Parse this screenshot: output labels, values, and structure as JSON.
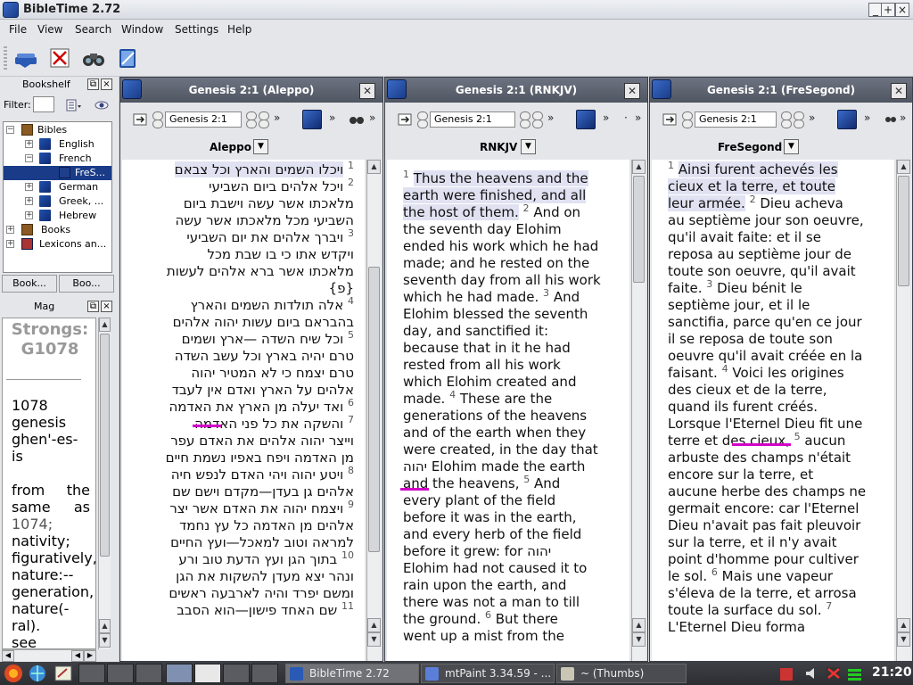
{
  "window": {
    "title": "BibleTime 2.72",
    "min": "_",
    "max": "+",
    "close": "×"
  },
  "menubar": [
    "File",
    "View",
    "Search",
    "Window",
    "Settings",
    "Help"
  ],
  "bookshelf": {
    "title": "Bookshelf",
    "filter_label": "Filter:",
    "tree": [
      {
        "label": "Bibles",
        "level": 0,
        "expanded": true
      },
      {
        "label": "English",
        "level": 1
      },
      {
        "label": "French",
        "level": 1,
        "expanded": true
      },
      {
        "label": "FreS...",
        "level": 2,
        "selected": true
      },
      {
        "label": "German",
        "level": 1
      },
      {
        "label": "Greek, ...",
        "level": 1
      },
      {
        "label": "Hebrew",
        "level": 1
      },
      {
        "label": "Books",
        "level": 0
      },
      {
        "label": "Lexicons an...",
        "level": 0
      }
    ],
    "tabs": [
      "Book...",
      "Boo..."
    ]
  },
  "mag": {
    "title": "Mag",
    "heading": "Strongs: G1078",
    "lines": [
      "1078",
      "genesis",
      "ghen'-es-",
      "is",
      "",
      "from the",
      "same as",
      "1074;",
      "nativity;",
      "figuratively,",
      "nature:--",
      "generation,",
      "nature(-",
      "ral).",
      "see"
    ]
  },
  "panes": [
    {
      "title": "Genesis 2:1 (Aleppo)",
      "key": "Genesis 2:1",
      "module": "Aleppo",
      "dir": "rtl",
      "lines": [
        "<span class='vn'>1</span> <span class='hl'>ויכלו השמים והארץ וכל צבאם</span>",
        "<span class='vn'>2</span> ויכל אלהים ביום השביעי",
        "מלאכתו אשר עשה וישבת ביום",
        "השביעי מכל מלאכתו אשר עשה",
        "<span class='vn'>3</span> ויברך אלהים את יום השביעי",
        "ויקדש אתו כי בו שבת מכל",
        "מלאכתו אשר ברא אלהים לעשות",
        "{פ}",
        "<span class='vn'>4</span> אלה תולדות השמים והארץ",
        "בהבראם ביום עשות יהוה אלהים",
        "<span class='vn'>5</span> וכל שיח השדה —ארץ ושמים",
        "טרם יהיה בארץ וכל עשב השדה",
        "טרם יצמח כי לא המטיר יהוה",
        "אלהים על הארץ ואדם אין לעבד",
        "<span class='vn'>6</span> ואד יעלה מן הארץ את האדמה",
        "<span class='vn'>7</span> והשקה את כל פני האדמה",
        "וייצר יהוה אלהים את האדם עפר",
        "מן האדמה ויפח באפיו נשמת חיים",
        "<span class='vn'>8</span> ויטע יהוה ויהי האדם לנפש חיה",
        "אלהים גן בעדן—מקדם וישם שם",
        "<span class='vn'>9</span> ויצמח יהוה את האדם אשר יצר",
        "אלהים מן האדמה כל עץ נחמד",
        "למראה וטוב למאכל—ועץ החיים",
        "<span class='vn'>10</span> בתוך הגן ועץ הדעת טוב ורע",
        "ונהר יצא מעדן להשקות את הגן",
        "ומשם יפרד והיה לארבעה ראשים",
        "<span class='vn'>11</span> שם האחד פישון—הוא הסבב"
      ]
    },
    {
      "title": "Genesis 2:1 (RNKJV)",
      "key": "Genesis 2:1",
      "module": "RNKJV",
      "dir": "ltr",
      "lines": [
        "<span class='vn'>1</span> <span class='hl'>Thus the heavens and the</span>",
        "<span class='hl'>earth were finished, and all</span>",
        "<span class='hl'>the host of them.</span> <span class='vn'>2</span> And on",
        "the seventh day Elohim",
        "ended his work which he had",
        "made; and he rested on the",
        "seventh day from all his work",
        "which he had made. <span class='vn'>3</span> And",
        "Elohim blessed the seventh",
        "day, and sanctified it:",
        "because that in it he had",
        "rested from all his work",
        "which Elohim created and",
        "made. <span class='vn'>4</span> These are the",
        "generations of the heavens",
        "and of the earth when they",
        "were created, in the day that",
        "יהוה Elohim made the earth",
        "and the heavens, <span class='vn'>5</span> And",
        "every plant of the field",
        "before it was in the earth,",
        "and every herb of the field",
        "before it grew: for יהוה",
        "Elohim had not caused it to",
        "rain upon the earth, and",
        "there was not a man to till",
        "the ground. <span class='vn'>6</span> But there",
        "went up a mist from the"
      ]
    },
    {
      "title": "Genesis 2:1 (FreSegond)",
      "key": "Genesis 2:1",
      "module": "FreSegond",
      "dir": "ltr",
      "lines": [
        "<span class='vn'>1</span> <span class='hl'>Ainsi furent achevés les</span>",
        "<span class='hl'>cieux et la terre, et toute</span>",
        "<span class='hl'>leur armée.</span> <span class='vn'>2</span> Dieu acheva",
        "au septième jour son oeuvre,",
        "qu'il avait faite: et il se",
        "reposa au septième jour de",
        "toute son oeuvre, qu'il avait",
        "faite. <span class='vn'>3</span> Dieu bénit le",
        "septième jour, et il le",
        "sanctifia, parce qu'en ce jour",
        "il se reposa de toute son",
        "oeuvre qu'il avait créée en la",
        "faisant. <span class='vn'>4</span> Voici les origines",
        "des cieux et de la terre,",
        "quand ils furent créés.",
        "Lorsque l'Eternel Dieu fit une",
        "terre et des cieux, <span class='vn'>5</span> aucun",
        "arbuste des champs n'était",
        "encore sur la terre, et",
        "aucune herbe des champs ne",
        "germait encore: car l'Eternel",
        "Dieu n'avait pas fait pleuvoir",
        "sur la terre, et il n'y avait",
        "point d'homme pour cultiver",
        "le sol. <span class='vn'>6</span> Mais une vapeur",
        "s'éleva de la terre, et arrosa",
        "toute la surface du sol. <span class='vn'>7</span>",
        "L'Eternel Dieu forma"
      ]
    }
  ],
  "taskbar": {
    "tasks": [
      "BibleTime 2.72",
      "mtPaint 3.34.59 - ...",
      "~ (Thumbs)"
    ],
    "clock": "21:20"
  }
}
